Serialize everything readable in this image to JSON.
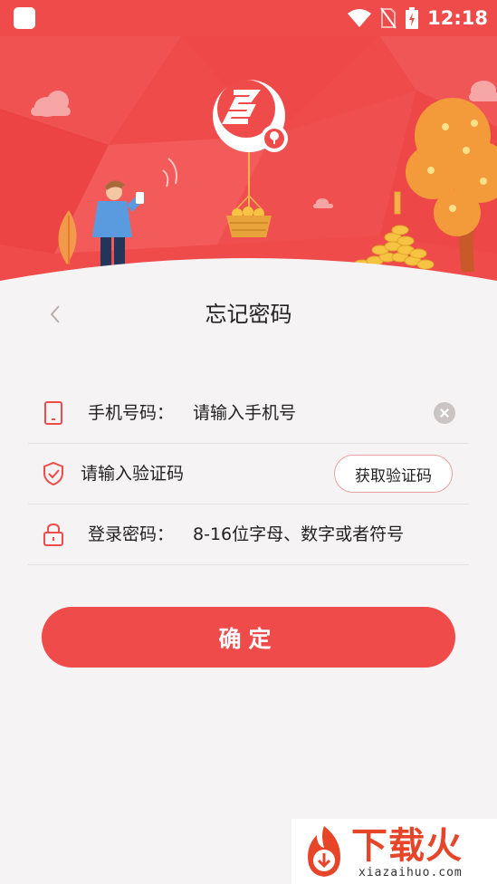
{
  "status_bar": {
    "time": "12:18"
  },
  "header": {
    "title": "忘记密码"
  },
  "form": {
    "phone": {
      "label": "手机号码：",
      "placeholder": "请输入手机号"
    },
    "code": {
      "placeholder": "请输入验证码",
      "get_code_label": "获取验证码"
    },
    "password": {
      "label": "登录密码：",
      "placeholder": "8-16位字母、数字或者符号"
    }
  },
  "confirm_label": "确定",
  "watermark": {
    "brand": "下载火",
    "domain": "xiazaihuo.com"
  },
  "colors": {
    "accent": "#ef4b4b",
    "divider": "#e3e0e0",
    "background": "#f5f3f3"
  }
}
